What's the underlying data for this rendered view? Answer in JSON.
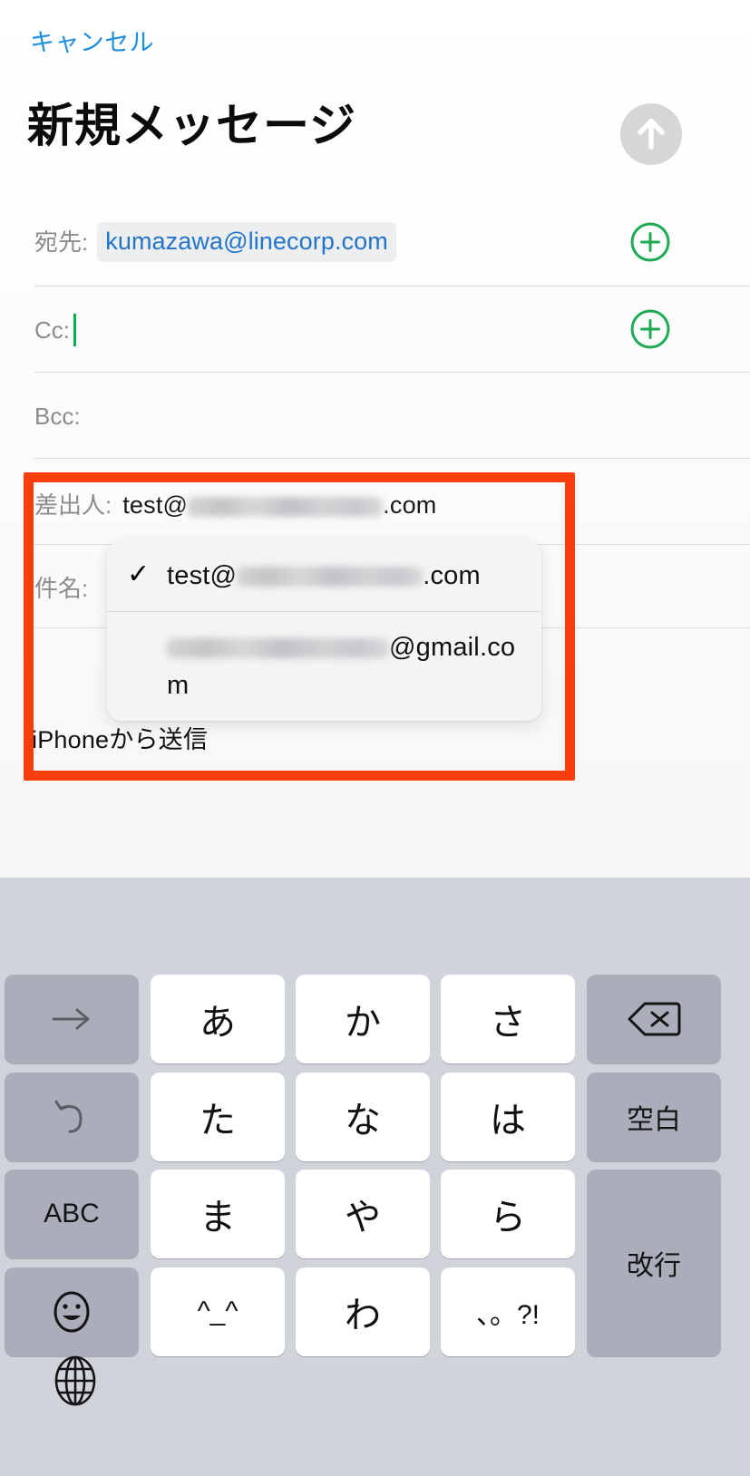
{
  "app": {
    "header": {
      "cancel_label": "キャンセル",
      "title": "新規メッセージ",
      "send_icon": "arrow-up-icon"
    },
    "accent_colors": {
      "link_blue": "#1d8fe0",
      "token_blue": "#2275c9",
      "add_green": "#1faa54",
      "caret_green": "#00b04a",
      "annotation_red": "#f93d0c",
      "send_disabled_grey": "#d6d6d6"
    }
  },
  "compose": {
    "fields": [
      {
        "key": "to",
        "label": "宛先:",
        "value": "kumazawa@linecorp.com",
        "has_add_button": true,
        "add_icon": "plus-circle-icon"
      },
      {
        "key": "cc",
        "label": "Cc:",
        "value": "",
        "has_add_button": true,
        "has_caret": true,
        "add_icon": "plus-circle-icon"
      },
      {
        "key": "bcc",
        "label": "Bcc:",
        "value": "",
        "has_add_button": false
      }
    ],
    "from": {
      "label": "差出人:",
      "value_prefix": "test@",
      "value_redacted": true,
      "value_suffix": ".com"
    },
    "subject": {
      "label": "件名:",
      "value": ""
    },
    "body": {
      "signature": "iPhoneから送信"
    }
  },
  "account_popup": {
    "options": [
      {
        "selected": true,
        "check_glyph": "✓",
        "text_prefix": "test@",
        "redacted": true,
        "text_suffix": ".com"
      },
      {
        "selected": false,
        "check_glyph": "",
        "text_prefix": "",
        "redacted": true,
        "text_suffix": "@gmail.com"
      }
    ]
  },
  "annotation": {
    "type": "red-rectangle-highlight",
    "color": "#f93d0c"
  },
  "keyboard": {
    "layout": "japanese-kana-12key",
    "rows": [
      [
        {
          "label": "→",
          "type": "func",
          "name": "cursor-right-key"
        },
        {
          "label": "あ",
          "type": "letter",
          "name": "kana-a-key"
        },
        {
          "label": "か",
          "type": "letter",
          "name": "kana-ka-key"
        },
        {
          "label": "さ",
          "type": "letter",
          "name": "kana-sa-key"
        },
        {
          "label": "",
          "type": "func",
          "name": "backspace-key",
          "icon": "backspace-icon"
        }
      ],
      [
        {
          "label": "",
          "type": "func",
          "name": "undo-key",
          "icon": "undo-arrow-icon"
        },
        {
          "label": "た",
          "type": "letter",
          "name": "kana-ta-key"
        },
        {
          "label": "な",
          "type": "letter",
          "name": "kana-na-key"
        },
        {
          "label": "は",
          "type": "letter",
          "name": "kana-ha-key"
        },
        {
          "label": "空白",
          "type": "func",
          "name": "space-key"
        }
      ],
      [
        {
          "label": "ABC",
          "type": "func",
          "name": "abc-mode-key"
        },
        {
          "label": "ま",
          "type": "letter",
          "name": "kana-ma-key"
        },
        {
          "label": "や",
          "type": "letter",
          "name": "kana-ya-key"
        },
        {
          "label": "ら",
          "type": "letter",
          "name": "kana-ra-key"
        },
        {
          "label": "改行",
          "type": "func",
          "name": "return-key"
        }
      ],
      [
        {
          "label": "",
          "type": "func",
          "name": "emoji-key",
          "icon": "smiley-face-icon"
        },
        {
          "label": "^_^",
          "type": "letter",
          "name": "kaomoji-key"
        },
        {
          "label": "わ",
          "type": "letter",
          "name": "kana-wa-key"
        },
        {
          "label": "、。?!",
          "type": "letter",
          "name": "punctuation-key"
        }
      ]
    ],
    "globe": {
      "icon": "globe-icon",
      "name": "language-switch-key"
    }
  }
}
